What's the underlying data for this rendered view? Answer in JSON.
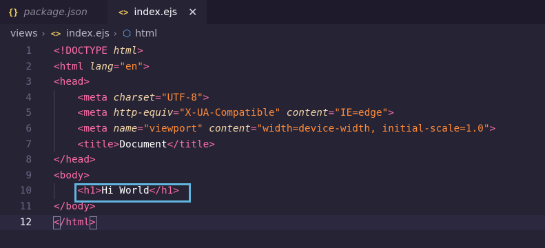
{
  "tabs": [
    {
      "icon": "{}",
      "label": "package.json",
      "active": false
    },
    {
      "icon": "<>",
      "label": "index.ejs",
      "active": true,
      "close": "✕"
    }
  ],
  "breadcrumb": {
    "folder": "views",
    "file_icon": "<>",
    "file": "index.ejs",
    "symbol_icon": "⬡",
    "symbol": "html",
    "separator": "›"
  },
  "editor": {
    "current_line": 12,
    "lines": [
      {
        "n": "1",
        "indent": "",
        "tokens": [
          [
            "t",
            "<!DOCTYPE "
          ],
          [
            "a",
            "html"
          ],
          [
            "t",
            ">"
          ]
        ]
      },
      {
        "n": "2",
        "indent": "",
        "tokens": [
          [
            "t",
            "<html "
          ],
          [
            "a",
            "lang"
          ],
          [
            "t",
            "="
          ],
          [
            "s",
            "\"en\""
          ],
          [
            "t",
            ">"
          ]
        ]
      },
      {
        "n": "3",
        "indent": "",
        "tokens": [
          [
            "t",
            "<head>"
          ]
        ]
      },
      {
        "n": "4",
        "indent": "    ",
        "tokens": [
          [
            "t",
            "<meta "
          ],
          [
            "a",
            "charset"
          ],
          [
            "t",
            "="
          ],
          [
            "s",
            "\"UTF-8\""
          ],
          [
            "t",
            ">"
          ]
        ]
      },
      {
        "n": "5",
        "indent": "    ",
        "tokens": [
          [
            "t",
            "<meta "
          ],
          [
            "a",
            "http-equiv"
          ],
          [
            "t",
            "="
          ],
          [
            "s",
            "\"X-UA-Compatible\""
          ],
          [
            "w",
            " "
          ],
          [
            "a",
            "content"
          ],
          [
            "t",
            "="
          ],
          [
            "s",
            "\"IE=edge\""
          ],
          [
            "t",
            ">"
          ]
        ]
      },
      {
        "n": "6",
        "indent": "    ",
        "tokens": [
          [
            "t",
            "<meta "
          ],
          [
            "a",
            "name"
          ],
          [
            "t",
            "="
          ],
          [
            "s",
            "\"viewport\""
          ],
          [
            "w",
            " "
          ],
          [
            "a",
            "content"
          ],
          [
            "t",
            "="
          ],
          [
            "s",
            "\"width=device-width, initial-scale=1.0\""
          ],
          [
            "t",
            ">"
          ]
        ]
      },
      {
        "n": "7",
        "indent": "    ",
        "tokens": [
          [
            "t",
            "<title>"
          ],
          [
            "w",
            "Document"
          ],
          [
            "t",
            "</title>"
          ]
        ]
      },
      {
        "n": "8",
        "indent": "",
        "tokens": [
          [
            "t",
            "</head>"
          ]
        ]
      },
      {
        "n": "9",
        "indent": "",
        "tokens": [
          [
            "t",
            "<body>"
          ]
        ]
      },
      {
        "n": "10",
        "indent": "    ",
        "tokens": [
          [
            "t",
            "<h1>"
          ],
          [
            "w",
            "Hi World"
          ],
          [
            "t",
            "</h1>"
          ]
        ]
      },
      {
        "n": "11",
        "indent": "",
        "tokens": [
          [
            "t",
            "</body>"
          ]
        ]
      },
      {
        "n": "12",
        "indent": "",
        "tokens": [
          [
            "t",
            "</html>"
          ]
        ]
      }
    ]
  },
  "colors": {
    "tag": "#fe6fa8",
    "attribute": "#f2d5a8",
    "string": "#ff8b39",
    "highlight_box": "#62b6de",
    "background": "#262335"
  }
}
